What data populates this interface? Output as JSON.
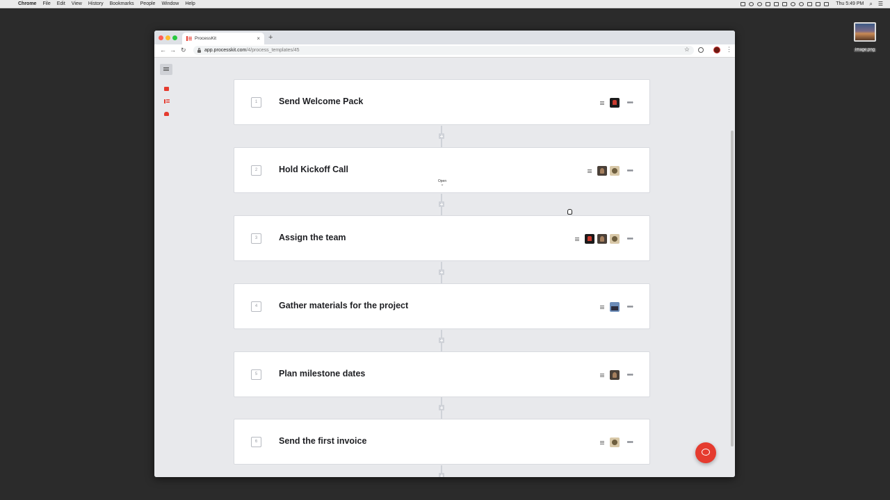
{
  "menubar": {
    "app": "Chrome",
    "items": [
      "File",
      "Edit",
      "View",
      "History",
      "Bookmarks",
      "People",
      "Window",
      "Help"
    ],
    "clock": "Thu 5:49 PM"
  },
  "desktop": {
    "file_label": "image.png"
  },
  "browser": {
    "tab_title": "ProcessKit",
    "url_host": "app.processkit.com",
    "url_path": "/4/process_templates/45"
  },
  "open_hint": "Open",
  "steps": [
    {
      "number": "1",
      "title": "Send Welcome Pack",
      "assignees": [
        "red"
      ]
    },
    {
      "number": "2",
      "title": "Hold Kickoff Call",
      "assignees": [
        "dark",
        "tan"
      ]
    },
    {
      "number": "3",
      "title": "Assign the team",
      "assignees": [
        "red",
        "dark",
        "tan"
      ]
    },
    {
      "number": "4",
      "title": "Gather materials for the project",
      "assignees": [
        "blue"
      ]
    },
    {
      "number": "5",
      "title": "Plan milestone dates",
      "assignees": [
        "dark"
      ]
    },
    {
      "number": "6",
      "title": "Send the first invoice",
      "assignees": [
        "tan"
      ]
    }
  ],
  "colors": {
    "accent": "#e53b2f",
    "background": "#e8e9ec"
  },
  "icons": {
    "sidebar": [
      "sidebar-toggle-icon",
      "briefcase-icon",
      "list-icon",
      "users-icon"
    ],
    "step": [
      "description-icon",
      "more-icon"
    ],
    "chat": "chat-icon"
  }
}
